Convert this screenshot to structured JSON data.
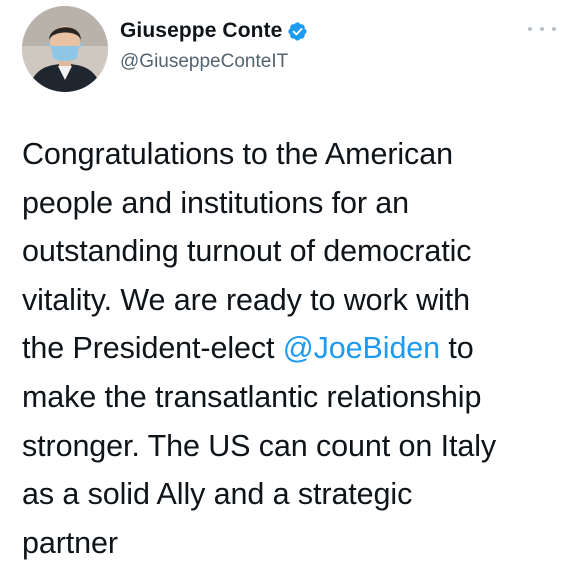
{
  "user": {
    "display_name": "Giuseppe Conte",
    "handle": "@GiuseppeConteIT",
    "avatar_icon": "user-avatar-photo",
    "verified_icon": "verified-badge-icon",
    "verified_color": "#1d9bf0"
  },
  "menu": {
    "icon": "more-options-icon"
  },
  "tweet": {
    "line1": "Congratulations to the American",
    "line2": "people and institutions for an",
    "line3": "outstanding turnout of democratic",
    "line4": "vitality. We are ready to work with",
    "line5_pre": "the President-elect ",
    "line5_mention": "@JoeBiden",
    "line5_post": " to",
    "line6": "make the transatlantic relationship",
    "line7": "stronger. The US can count on Italy",
    "line8": "as a solid Ally and a strategic",
    "line9": "partner",
    "mention_color": "#1d9bf0"
  }
}
